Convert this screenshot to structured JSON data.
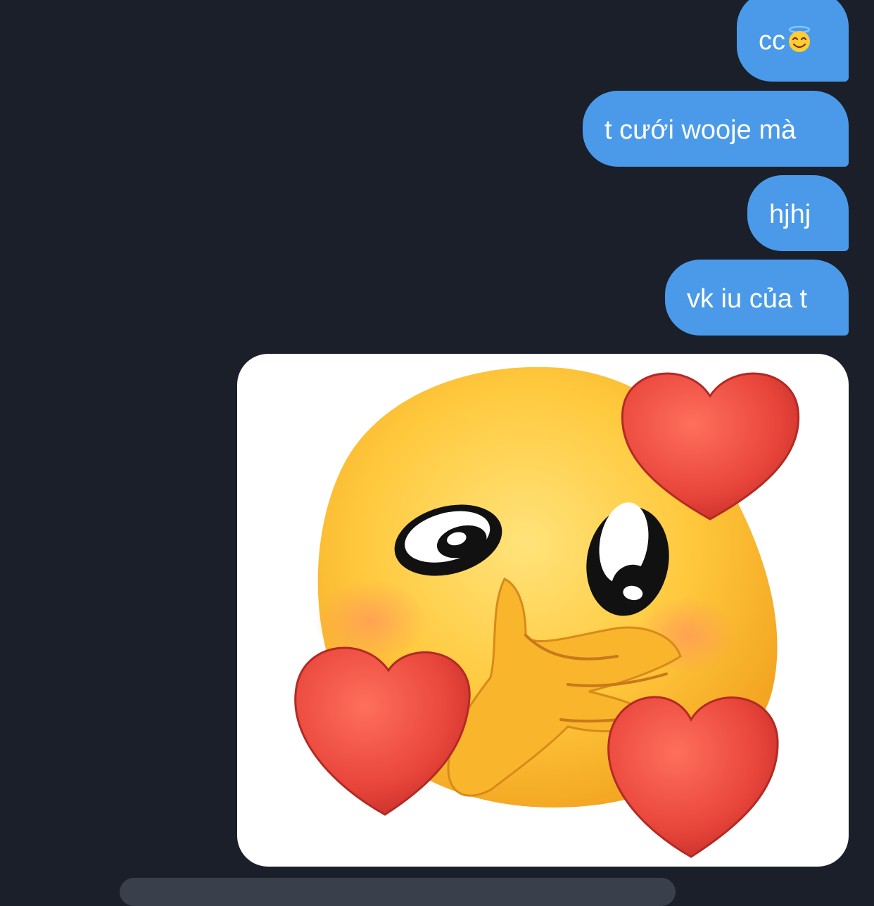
{
  "messages": [
    {
      "text": "cc",
      "emoji": "smiling-face-with-halo"
    },
    {
      "text": "t cưới wooje mà"
    },
    {
      "text": "hjhj"
    },
    {
      "text": "vk iu của t"
    }
  ],
  "image_message": {
    "subject": "pleading-emoji-with-hearts-sticker"
  },
  "colors": {
    "background": "#1a1f29",
    "sent_bubble": "#4a9ae9",
    "bubble_text": "#ffffff"
  }
}
